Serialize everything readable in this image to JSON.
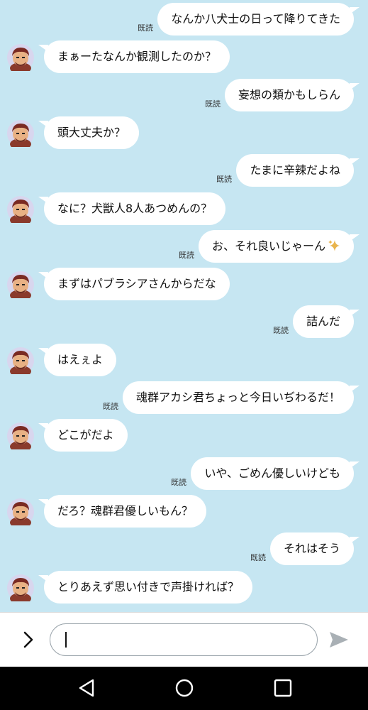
{
  "read_label": "既読",
  "colors": {
    "background": "#c6e6f2",
    "bubble": "#ffffff",
    "send_arrow": "#a9b0b5",
    "sparkle": "#e9b44c"
  },
  "messages": [
    {
      "side": "right",
      "text": "なんか八犬士の日って降りてきた",
      "read": true
    },
    {
      "side": "left",
      "text": "まぁーたなんか観測したのか？"
    },
    {
      "side": "right",
      "text": "妄想の類かもしらん",
      "read": true
    },
    {
      "side": "left",
      "text": "頭大丈夫か？"
    },
    {
      "side": "right",
      "text": "たまに辛辣だよね",
      "read": true
    },
    {
      "side": "left",
      "text": "なに？犬獣人8人あつめんの？"
    },
    {
      "side": "right",
      "text": "お、それ良いじゃーん",
      "read": true,
      "emoji": "sparkle-icon"
    },
    {
      "side": "left",
      "text": "まずはパブラシアさんからだな"
    },
    {
      "side": "right",
      "text": "詰んだ",
      "read": true
    },
    {
      "side": "left",
      "text": "はえぇよ"
    },
    {
      "side": "right",
      "text": "魂群アカシ君ちょっと今日いぢわるだ！",
      "read": true
    },
    {
      "side": "left",
      "text": "どこがだよ"
    },
    {
      "side": "right",
      "text": "いや、ごめん優しいけども",
      "read": true
    },
    {
      "side": "left",
      "text": "だろ？魂群君優しいもん？"
    },
    {
      "side": "right",
      "text": "それはそう",
      "read": true
    },
    {
      "side": "left",
      "text": "とりあえず思い付きで声掛ければ？"
    }
  ],
  "input": {
    "value": "",
    "expand_icon": "chevron-right-icon",
    "send_icon": "send-icon"
  },
  "navbar": {
    "icons": [
      "back-icon",
      "home-icon",
      "recents-icon"
    ]
  }
}
